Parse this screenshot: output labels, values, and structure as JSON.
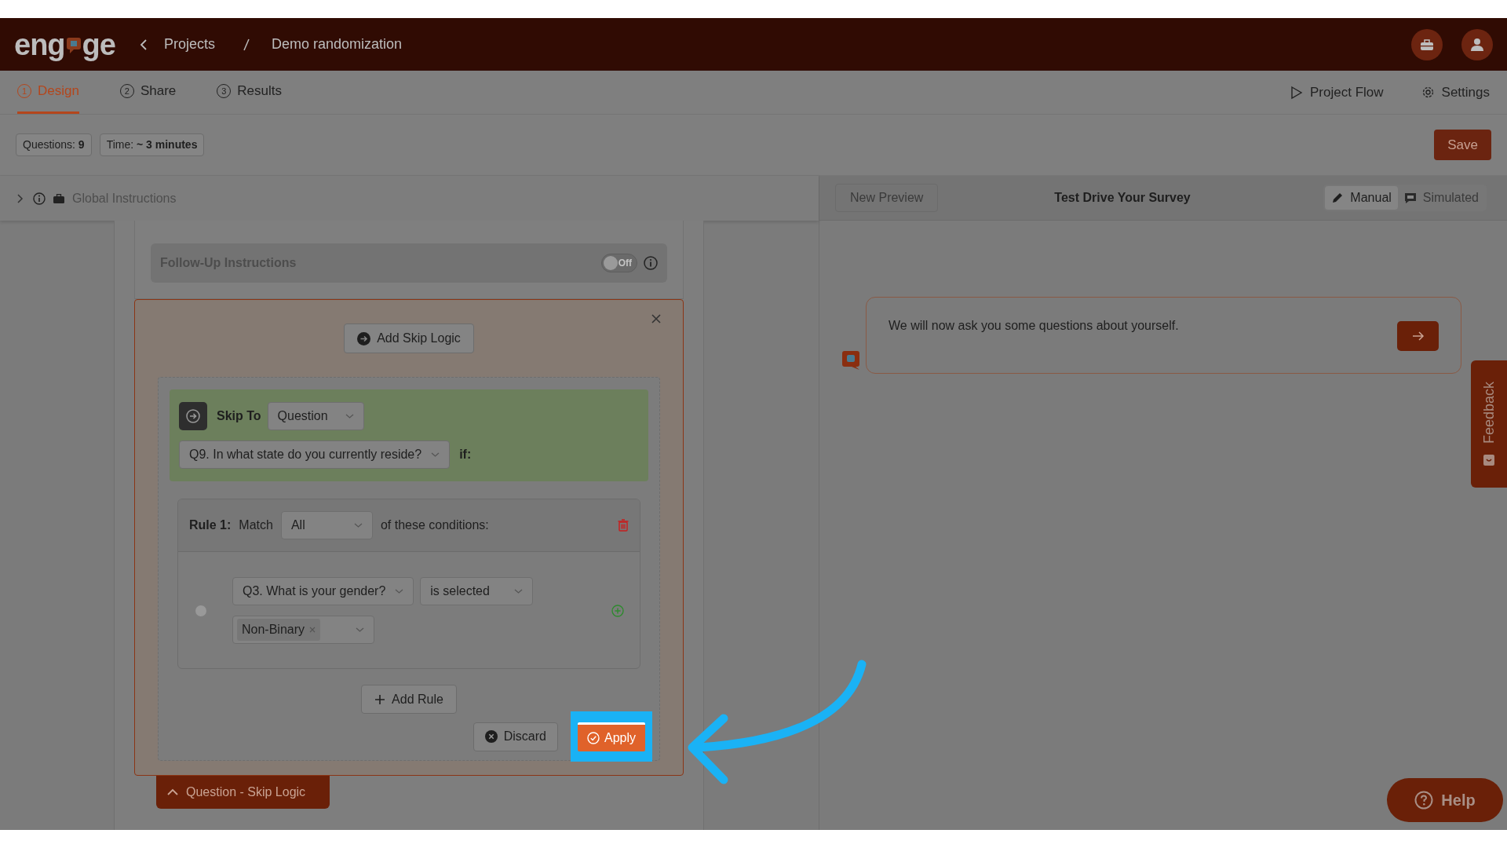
{
  "header": {
    "logo": [
      "eng",
      "ge"
    ],
    "breadcrumb": [
      {
        "label": "Projects"
      },
      {
        "label": "Demo randomization"
      }
    ]
  },
  "tabs": [
    {
      "step": "1",
      "label": "Design",
      "selected": true
    },
    {
      "step": "2",
      "label": "Share",
      "selected": false
    },
    {
      "step": "3",
      "label": "Results",
      "selected": false
    }
  ],
  "actions": [
    {
      "kind": "play",
      "label": "Project Flow"
    },
    {
      "kind": "gear",
      "label": "Settings"
    }
  ],
  "stats": [
    {
      "label": "Questions:",
      "value": "9"
    },
    {
      "label": "Time:",
      "value": "~ 3 minutes"
    }
  ],
  "save": "Save",
  "global_instructions": {
    "label": "Global Instructions",
    "expanded": false
  },
  "follow_up": {
    "label": "Follow-Up Instructions",
    "on": false,
    "toggle_text": "Off"
  },
  "skip_logic": {
    "add_button": "Add Skip Logic",
    "skip_to_label": "Skip To",
    "skip_to_type": "Question",
    "target": "Q9. In what state do you currently reside?",
    "if_label": "if:",
    "rules": [
      {
        "label": "Rule 1:",
        "match_label": "Match",
        "match": "All",
        "suffix": "of these conditions:",
        "conditions": [
          {
            "question": "Q3. What is your gender?",
            "operator": "is selected",
            "values": [
              "Non-Binary"
            ]
          }
        ]
      }
    ],
    "add_rule": "Add Rule",
    "discard": "Discard",
    "apply": "Apply"
  },
  "section_tab": "Question - Skip Logic",
  "preview": {
    "new_preview": "New Preview",
    "title": "Test Drive Your Survey",
    "modes": [
      {
        "kind": "pencil",
        "label": "Manual",
        "selected": true
      },
      {
        "kind": "chat",
        "label": "Simulated",
        "selected": false
      }
    ],
    "message": "We will now ask you some questions about yourself."
  },
  "feedback": "Feedback",
  "help": "Help"
}
